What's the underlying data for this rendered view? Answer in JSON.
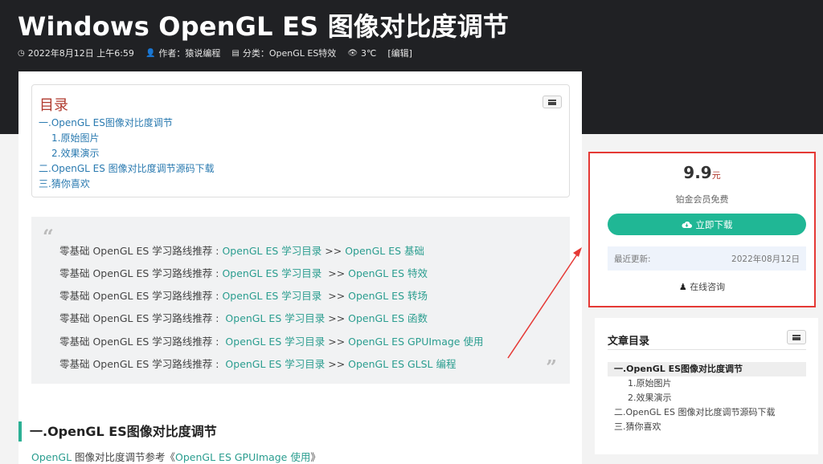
{
  "header": {
    "title": "Windows OpenGL ES 图像对比度调节",
    "date": "2022年8月12日 上午6:59",
    "author": "作者：猿说编程",
    "category": "分类：OpenGL ES特效",
    "views": "3℃",
    "edit": "[编辑]"
  },
  "toc": {
    "title": "目录",
    "items": [
      {
        "label": "一.OpenGL ES图像对比度调节",
        "sub": false
      },
      {
        "label": "1.原始图片",
        "sub": true
      },
      {
        "label": "2.效果演示",
        "sub": true
      },
      {
        "label": "二.OpenGL ES 图像对比度调节源码下载",
        "sub": false
      },
      {
        "label": "三.猜你喜欢",
        "sub": false
      }
    ]
  },
  "quote": {
    "lines": [
      {
        "prefix": "零基础 OpenGL ES 学习路线推荐 : ",
        "link1": "OpenGL ES 学习目录",
        "sep": " >> ",
        "link2": "OpenGL ES 基础"
      },
      {
        "prefix": "零基础 OpenGL ES 学习路线推荐 : ",
        "link1": "OpenGL ES 学习目录",
        "sep": "  >> ",
        "link2": "OpenGL ES 特效"
      },
      {
        "prefix": "零基础 OpenGL ES 学习路线推荐 : ",
        "link1": "OpenGL ES 学习目录",
        "sep": "  >> ",
        "link2": "OpenGL ES 转场"
      },
      {
        "prefix": "零基础 OpenGL ES 学习路线推荐 :  ",
        "link1": "OpenGL ES 学习目录",
        "sep": " >> ",
        "link2": "OpenGL ES 函数"
      },
      {
        "prefix": "零基础 OpenGL ES 学习路线推荐 :  ",
        "link1": "OpenGL ES 学习目录",
        "sep": " >> ",
        "link2": "OpenGL ES GPUImage 使用"
      },
      {
        "prefix": "零基础 OpenGL ES 学习路线推荐 :  ",
        "link1": "OpenGL ES 学习目录",
        "sep": " >> ",
        "link2": "OpenGL ES GLSL 编程"
      }
    ]
  },
  "section": {
    "heading": "一.OpenGL ES图像对比度调节",
    "para_link1": "OpenGL",
    "para_text": " 图像对比度调节参考《",
    "para_link2": "OpenGL ES GPUImage 使用",
    "para_end": "》"
  },
  "download": {
    "price": "9.9",
    "currency": "元",
    "member": "铂金会员免费",
    "button": "立即下载",
    "update_label": "最近更新:",
    "update_date": "2022年08月12日",
    "consult": "在线咨询"
  },
  "side_toc": {
    "title": "文章目录",
    "items": [
      {
        "label": "一.OpenGL ES图像对比度调节",
        "type": "active"
      },
      {
        "label": "1.原始图片",
        "type": "sub"
      },
      {
        "label": "2.效果演示",
        "type": "sub"
      },
      {
        "label": "二.OpenGL ES 图像对比度调节源码下载",
        "type": "top"
      },
      {
        "label": "三.猜你喜欢",
        "type": "top"
      }
    ]
  },
  "colors": {
    "header_bg": "#202124",
    "accent": "#20b795",
    "link": "#2a7ab0",
    "annotation": "#e53935"
  }
}
